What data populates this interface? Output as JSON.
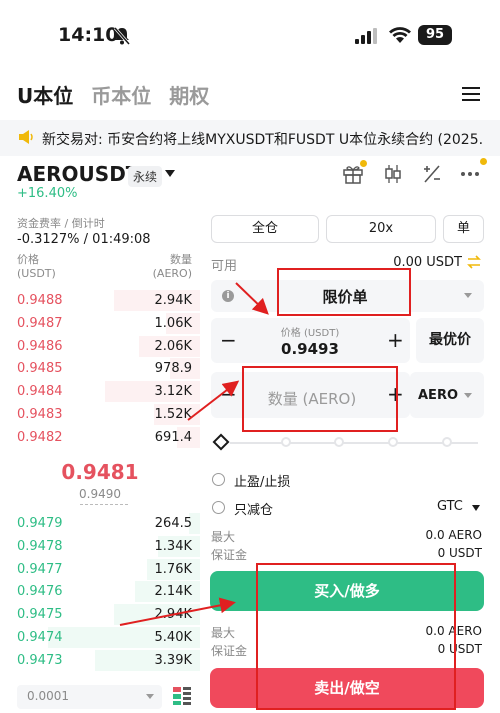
{
  "status": {
    "time": "14:10",
    "battery": "95"
  },
  "tabs": [
    {
      "label": "U本位",
      "active": true
    },
    {
      "label": "币本位",
      "active": false
    },
    {
      "label": "期权",
      "active": false
    }
  ],
  "announcement": "新交易对: 币安合约将上线MYXUSDT和FUSDT U本位永续合约 (2025...",
  "symbol": {
    "name": "AEROUSDT",
    "badge": "永续",
    "change": "+16.40%"
  },
  "funding": {
    "label": "资金费率 / 倒计时",
    "value": "-0.3127% / 01:49:08"
  },
  "orderbook": {
    "price_header": "价格",
    "price_unit": "(USDT)",
    "qty_header": "数量",
    "qty_unit": "(AERO)",
    "asks": [
      {
        "price": "0.9488",
        "qty": "2.94K",
        "depth": 0.45
      },
      {
        "price": "0.9487",
        "qty": "1.06K",
        "depth": 0.18
      },
      {
        "price": "0.9486",
        "qty": "2.06K",
        "depth": 0.32
      },
      {
        "price": "0.9485",
        "qty": "978.9",
        "depth": 0.16
      },
      {
        "price": "0.9484",
        "qty": "3.12K",
        "depth": 0.5
      },
      {
        "price": "0.9483",
        "qty": "1.52K",
        "depth": 0.24
      },
      {
        "price": "0.9482",
        "qty": "691.4",
        "depth": 0.12
      }
    ],
    "mid_price": "0.9481",
    "mark_price": "0.9490",
    "bids": [
      {
        "price": "0.9479",
        "qty": "264.5",
        "depth": 0.06
      },
      {
        "price": "0.9478",
        "qty": "1.34K",
        "depth": 0.22
      },
      {
        "price": "0.9477",
        "qty": "1.76K",
        "depth": 0.28
      },
      {
        "price": "0.9476",
        "qty": "2.14K",
        "depth": 0.34
      },
      {
        "price": "0.9475",
        "qty": "2.94K",
        "depth": 0.45
      },
      {
        "price": "0.9474",
        "qty": "5.40K",
        "depth": 0.8
      },
      {
        "price": "0.9473",
        "qty": "3.39K",
        "depth": 0.55
      }
    ],
    "tick_size": "0.0001"
  },
  "panel": {
    "margin_mode": "全仓",
    "leverage": "20x",
    "position_mode": "单",
    "available_label": "可用",
    "available_value": "0.00 USDT",
    "order_type": "限价单",
    "price_label": "价格 (USDT)",
    "price_value": "0.9493",
    "best_price": "最优价",
    "qty_placeholder": "数量 (AERO)",
    "qty_unit": "AERO",
    "tp_sl": "止盈/止损",
    "reduce_only": "只减仓",
    "tif": "GTC",
    "buy_max_label": "最大",
    "buy_max_value": "0.0 AERO",
    "buy_margin_label": "保证金",
    "buy_margin_value": "0 USDT",
    "buy_button": "买入/做多",
    "sell_max_label": "最大",
    "sell_max_value": "0.0 AERO",
    "sell_margin_label": "保证金",
    "sell_margin_value": "0 USDT",
    "sell_button": "卖出/做空"
  },
  "colors": {
    "buy": "#2ebd85",
    "sell": "#f0495c",
    "annotation": "#e02020"
  },
  "icons": [
    "bell-slash-icon",
    "signal-icon",
    "wifi-icon",
    "menu-icon",
    "speaker-icon",
    "gift-icon",
    "candlestick-icon",
    "calculator-icon",
    "more-icon",
    "swap-icon",
    "info-icon",
    "layout-icon"
  ]
}
